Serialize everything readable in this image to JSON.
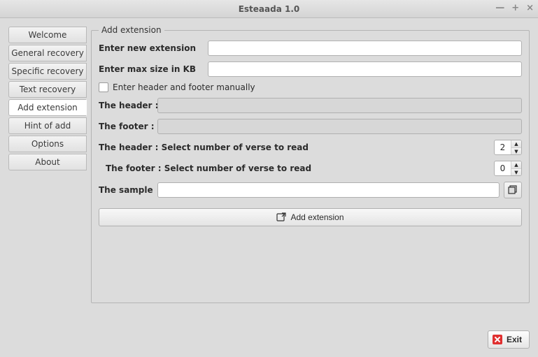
{
  "window": {
    "title": "Esteaada 1.0"
  },
  "sidebar": {
    "items": [
      {
        "label": "Welcome"
      },
      {
        "label": "General recovery"
      },
      {
        "label": "Specific recovery"
      },
      {
        "label": "Text recovery"
      },
      {
        "label": "Add extension"
      },
      {
        "label": "Hint of add"
      },
      {
        "label": "Options"
      },
      {
        "label": "About"
      }
    ],
    "selected_index": 4
  },
  "group": {
    "legend": "Add extension",
    "new_ext_label": "Enter new extension",
    "new_ext_value": "",
    "max_size_label": "Enter max size in KB",
    "max_size_value": "",
    "manual_checkbox_label": "Enter header and footer manually",
    "manual_checked": false,
    "header_label": "The header :",
    "header_value": "",
    "footer_label": "The footer :",
    "footer_value": "",
    "header_verse_label": "The header : Select number of verse to read",
    "header_verse_value": "2",
    "footer_verse_label": "The footer : Select number of verse to read",
    "footer_verse_value": "0",
    "sample_label": "The sample",
    "sample_value": "",
    "add_button_label": "Add extension"
  },
  "footer": {
    "exit_label": "Exit"
  }
}
